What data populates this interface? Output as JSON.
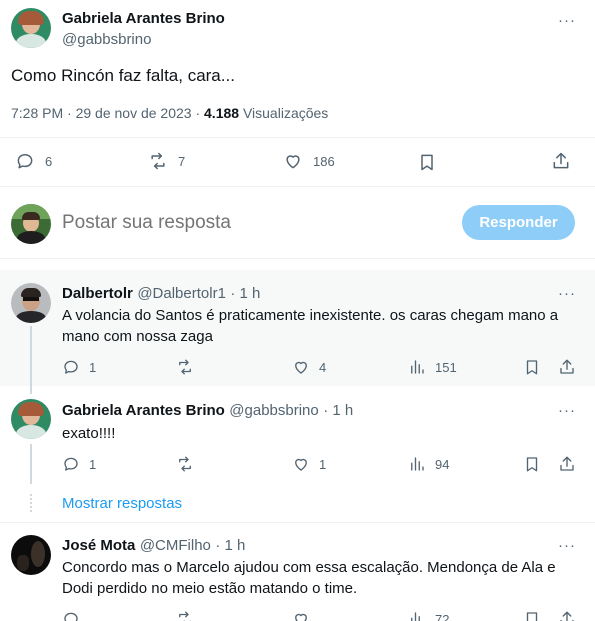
{
  "main_post": {
    "author": "Gabriela Arantes Brino",
    "handle": "@gabbsbrino",
    "text": "Como Rincón faz falta, cara...",
    "time": "7:28 PM · 29 de nov de 2023 · ",
    "views_count": "4.188",
    "views_label": " Visualizações",
    "replies": "6",
    "reposts": "7",
    "likes": "186"
  },
  "composer": {
    "placeholder": "Postar sua resposta",
    "button": "Responder"
  },
  "replies": [
    {
      "author": "Dalbertolr",
      "handle": "@Dalbertolr1",
      "time": "· 1 h",
      "text": "A volancia do Santos é praticamente inexistente. os caras chegam mano a mano com nossa zaga",
      "replies": "1",
      "likes": "4",
      "views": "151"
    },
    {
      "author": "Gabriela Arantes Brino",
      "handle": "@gabbsbrino",
      "time": "· 1 h",
      "text": "exato!!!!",
      "replies": "1",
      "likes": "1",
      "views": "94"
    },
    {
      "author": "José Mota",
      "handle": "@CMFilho",
      "time": "· 1 h",
      "text": "Concordo mas o Marcelo ajudou com essa escalação. Mendonça de Ala e Dodi perdido no meio estão matando o time.",
      "views": "72"
    }
  ],
  "show_replies": "Mostrar respostas",
  "more": "···",
  "colors": {
    "accent": "#1d9bf0",
    "button_disabled": "#8ecdf8",
    "highlight_bg": "#f7f9f9"
  }
}
